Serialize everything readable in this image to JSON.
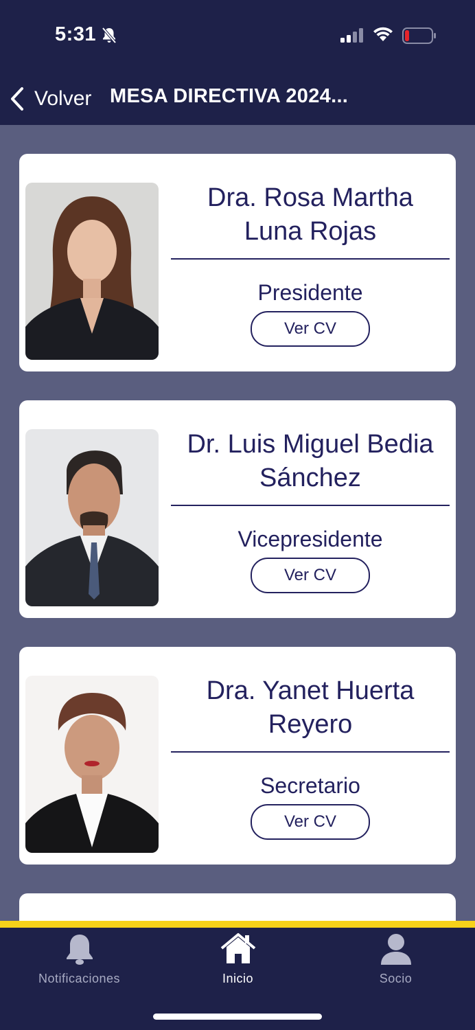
{
  "status_bar": {
    "time": "5:31"
  },
  "nav": {
    "back_label": "Volver",
    "title": "MESA DIRECTIVA 2024..."
  },
  "members": [
    {
      "name_line1": "Dra. Rosa Martha",
      "name_line2": "Luna Rojas",
      "role": "Presidente",
      "cv_label": "Ver CV"
    },
    {
      "name_line1": "Dr. Luis Miguel Bedia",
      "name_line2": "Sánchez",
      "role": "Vicepresidente",
      "cv_label": "Ver CV"
    },
    {
      "name_line1": "Dra. Yanet Huerta",
      "name_line2": "Reyero",
      "role": "Secretario",
      "cv_label": "Ver CV"
    }
  ],
  "tabbar": {
    "tabs": [
      {
        "label": "Notificaciones",
        "icon": "bell-icon"
      },
      {
        "label": "Inicio",
        "icon": "home-icon",
        "active": true
      },
      {
        "label": "Socio",
        "icon": "person-icon"
      }
    ]
  },
  "colors": {
    "header_bg": "#1e2149",
    "page_bg": "#5a5e7f",
    "accent_text": "#23215e",
    "highlight_line": "#f7d21a"
  }
}
